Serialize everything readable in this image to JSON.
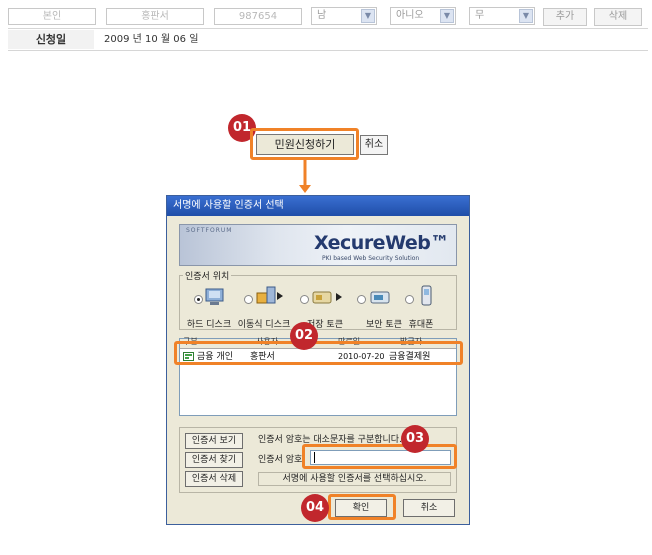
{
  "form": {
    "fields": [
      "본인",
      "홍판서",
      "987654"
    ],
    "selects": [
      "남",
      "아니오",
      "무"
    ],
    "add_label": "추가",
    "delete_label": "삭제",
    "apply_date_label": "신청일",
    "apply_date_value": "2009  년 10  월 06  일"
  },
  "steps": [
    "01",
    "02",
    "03",
    "04"
  ],
  "request": {
    "apply_label": "민원신청하기",
    "cancel_label": "취소"
  },
  "dialog": {
    "title": "서명에 사용할 인증서 선택",
    "brand_small": "SOFTFORUM",
    "brand_name": "XecureWeb™",
    "brand_tagline": "PKI based Web Security Solution",
    "location_group": "인증서 위치",
    "devices": [
      "하드 디스크",
      "이동식 디스크",
      "저장 토큰",
      "보안 토큰",
      "휴대폰"
    ],
    "columns": [
      "구분",
      "사용자",
      "만료일",
      "발급자"
    ],
    "rows": [
      {
        "type": "금융 개인",
        "user": "홍판서",
        "expiry": "2010-07-20",
        "issuer": "금융결제원"
      }
    ],
    "view_btn": "인증서 보기",
    "find_btn": "인증서 찾기",
    "delete_btn": "인증서 삭제",
    "password_hint": "인증서 암호는 대소문자를 구분합니다.",
    "password_label": "인증서 암호",
    "status_message": "서명에 사용할 인증서를 선택하십시오.",
    "ok_label": "확인",
    "cancel_label": "취소"
  },
  "colors": {
    "badge": "#c1272d",
    "highlight": "#f08228",
    "titlebar": "#2b5fc0"
  },
  "icons": [
    "select-arrow-icon",
    "hard-disk-icon",
    "usb-disk-icon",
    "storage-token-icon",
    "security-token-icon",
    "mobile-phone-icon",
    "certificate-icon",
    "arrow-down-icon"
  ]
}
